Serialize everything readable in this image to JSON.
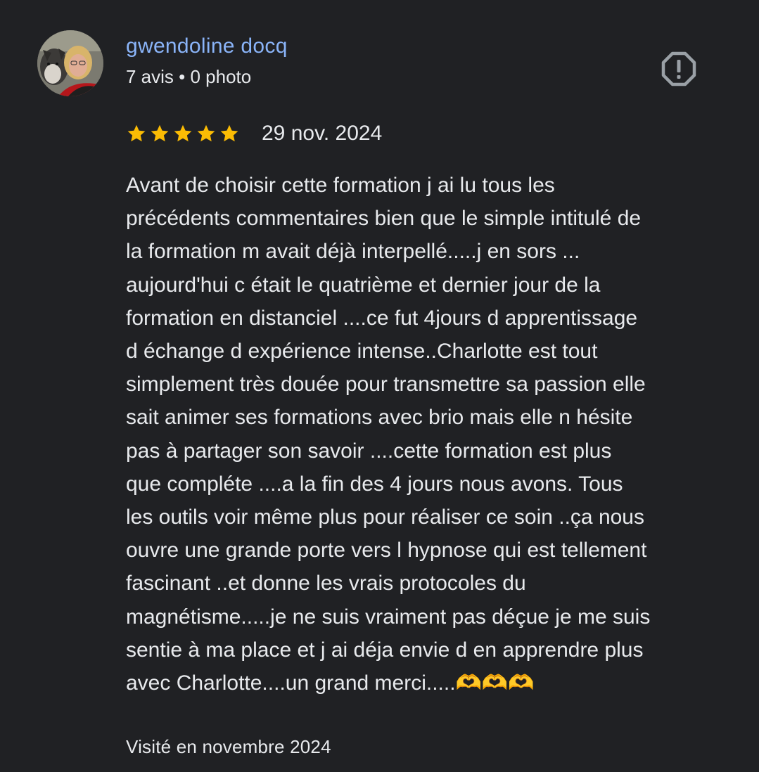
{
  "author": {
    "name": "gwendoline docq",
    "meta": "7 avis • 0 photo"
  },
  "icons": {
    "avatar": "profile-photo",
    "report": "report-flag-icon",
    "star": "star-icon"
  },
  "colors": {
    "background": "#202124",
    "author_link": "#8ab4f8",
    "star": "#fbbc04",
    "text": "#e8eaed",
    "icon": "#9aa0a6"
  },
  "review": {
    "rating": 5,
    "rating_max": 5,
    "date": "29 nov. 2024",
    "text_lines": [
      "Avant de choisir cette formation j ai lu tous les",
      "précédents commentaires bien que le simple intitulé de",
      "la formation m avait déjà interpellé.....j en sors ...",
      "aujourd'hui c était le quatrième et dernier jour de la",
      "formation en distanciel ....ce fut 4jours d apprentissage",
      "d échange d expérience intense..Charlotte est tout",
      "simplement très douée pour transmettre sa passion elle",
      "sait animer ses formations avec brio mais elle n hésite",
      "pas à partager son savoir ....cette formation est plus",
      "que compléte ....a la fin des 4 jours nous avons. Tous",
      "les outils voir même plus pour réaliser ce soin ..ça nous",
      "ouvre une grande porte vers l hypnose qui est tellement",
      "fascinant ..et donne les vrais protocoles du",
      "magnétisme.....je ne suis vraiment pas déçue je me suis",
      "sentie à ma place et j ai déja envie d en apprendre plus",
      "avec Charlotte....un grand merci.....🫶🫶🫶"
    ],
    "visited": "Visité en novembre 2024"
  }
}
